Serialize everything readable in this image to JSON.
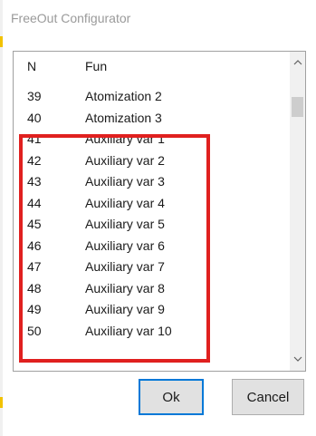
{
  "window": {
    "title": "FreeOut Configurator"
  },
  "list": {
    "columns": {
      "n": "N",
      "fun": "Fun"
    },
    "rows": [
      {
        "n": "39",
        "fun": "Atomization 2"
      },
      {
        "n": "40",
        "fun": "Atomization 3"
      },
      {
        "n": "41",
        "fun": "Auxiliary var 1"
      },
      {
        "n": "42",
        "fun": "Auxiliary var 2"
      },
      {
        "n": "43",
        "fun": "Auxiliary var 3"
      },
      {
        "n": "44",
        "fun": "Auxiliary var 4"
      },
      {
        "n": "45",
        "fun": "Auxiliary var 5"
      },
      {
        "n": "46",
        "fun": "Auxiliary var 6"
      },
      {
        "n": "47",
        "fun": "Auxiliary var 7"
      },
      {
        "n": "48",
        "fun": "Auxiliary var 8"
      },
      {
        "n": "49",
        "fun": "Auxiliary var 9"
      },
      {
        "n": "50",
        "fun": "Auxiliary var 10"
      }
    ],
    "scroll_up_icon": "chevron-up-icon",
    "scroll_down_icon": "chevron-down-icon"
  },
  "buttons": {
    "ok": "Ok",
    "cancel": "Cancel"
  },
  "colors": {
    "highlight": "#e0201f",
    "focus": "#0078d7"
  }
}
